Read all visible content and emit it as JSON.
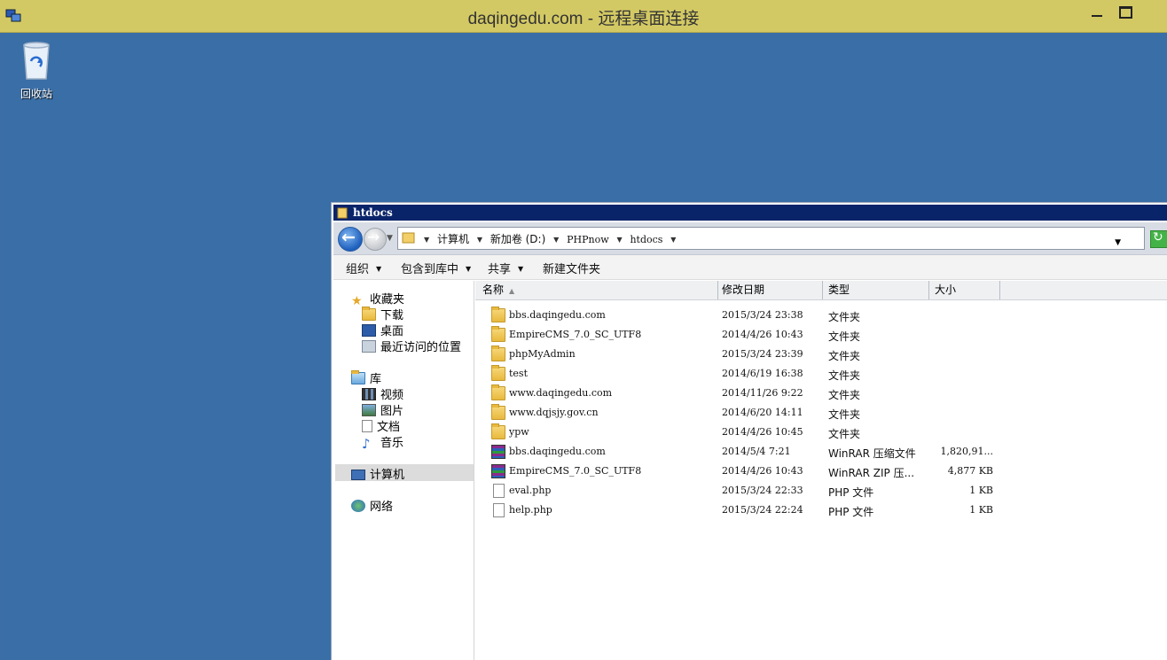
{
  "rdp": {
    "title": "daqingedu.com - 远程桌面连接"
  },
  "desktop": {
    "recycle_bin_label": "回收站"
  },
  "explorer": {
    "window_title": "htdocs",
    "breadcrumbs": [
      "计算机",
      "新加卷 (D:)",
      "PHPnow",
      "htdocs"
    ],
    "toolbar": {
      "organize": "组织",
      "include_in_library": "包含到库中",
      "share": "共享",
      "new_folder": "新建文件夹"
    },
    "nav": {
      "favorites": "收藏夹",
      "downloads": "下载",
      "desktop": "桌面",
      "recent_places": "最近访问的位置",
      "libraries": "库",
      "videos": "视频",
      "pictures": "图片",
      "documents": "文档",
      "music": "音乐",
      "computer": "计算机",
      "network": "网络"
    },
    "columns": {
      "name": "名称",
      "date": "修改日期",
      "type": "类型",
      "size": "大小"
    },
    "files": [
      {
        "icon": "folder",
        "name": "bbs.daqingedu.com",
        "date": "2015/3/24 23:38",
        "type": "文件夹",
        "size": ""
      },
      {
        "icon": "folder",
        "name": "EmpireCMS_7.0_SC_UTF8",
        "date": "2014/4/26 10:43",
        "type": "文件夹",
        "size": ""
      },
      {
        "icon": "folder",
        "name": "phpMyAdmin",
        "date": "2015/3/24 23:39",
        "type": "文件夹",
        "size": ""
      },
      {
        "icon": "folder",
        "name": "test",
        "date": "2014/6/19 16:38",
        "type": "文件夹",
        "size": ""
      },
      {
        "icon": "folder",
        "name": "www.daqingedu.com",
        "date": "2014/11/26 9:22",
        "type": "文件夹",
        "size": ""
      },
      {
        "icon": "folder",
        "name": "www.dqjsjy.gov.cn",
        "date": "2014/6/20 14:11",
        "type": "文件夹",
        "size": ""
      },
      {
        "icon": "folder",
        "name": "ypw",
        "date": "2014/4/26 10:45",
        "type": "文件夹",
        "size": ""
      },
      {
        "icon": "rar",
        "name": "bbs.daqingedu.com",
        "date": "2014/5/4 7:21",
        "type": "WinRAR 压缩文件",
        "size": "1,820,91..."
      },
      {
        "icon": "rar",
        "name": "EmpireCMS_7.0_SC_UTF8",
        "date": "2014/4/26 10:43",
        "type": "WinRAR ZIP 压...",
        "size": "4,877 KB"
      },
      {
        "icon": "file",
        "name": "eval.php",
        "date": "2015/3/24 22:33",
        "type": "PHP 文件",
        "size": "1 KB"
      },
      {
        "icon": "file",
        "name": "help.php",
        "date": "2015/3/24 22:24",
        "type": "PHP 文件",
        "size": "1 KB"
      }
    ]
  }
}
